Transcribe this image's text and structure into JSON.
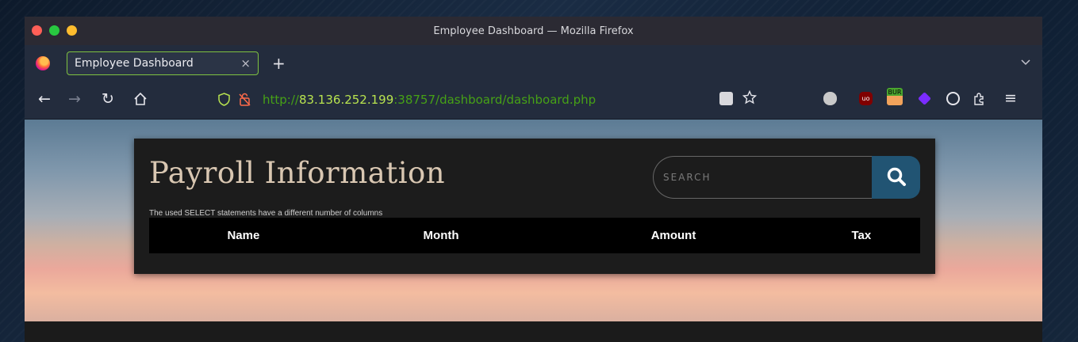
{
  "window": {
    "title": "Employee Dashboard — Mozilla Firefox"
  },
  "tabs": [
    {
      "label": "Employee Dashboard",
      "close_glyph": "×"
    }
  ],
  "new_tab_glyph": "+",
  "address": {
    "scheme": "http://",
    "host": "83.136.252.199",
    "rest": ":38757/dashboard/dashboard.php"
  },
  "page": {
    "title": "Payroll Information",
    "error_message": "The used SELECT statements have a different number of columns",
    "search": {
      "placeholder": "SEARCH",
      "value": ""
    },
    "table": {
      "columns": [
        "Name",
        "Month",
        "Amount",
        "Tax"
      ],
      "rows": []
    }
  },
  "extensions": {
    "burp_label": "BUR",
    "ublock_label": "uo"
  },
  "icons": [
    "firefox-icon",
    "back-icon",
    "forward-icon",
    "reload-icon",
    "home-icon",
    "shield-icon",
    "insecure-lock-icon",
    "reader-view-icon",
    "bookmark-star-icon",
    "search-icon",
    "menu-icon"
  ],
  "colors": {
    "tab_accent": "#7fc241",
    "url_host": "#b8e34f",
    "url_other": "#46a116",
    "search_button": "#215473",
    "title_text": "#d9c7b2"
  }
}
